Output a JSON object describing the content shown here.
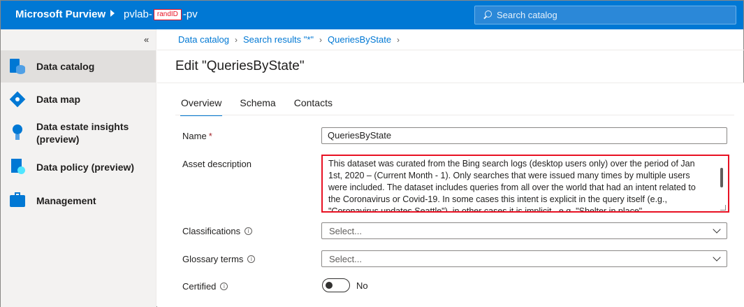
{
  "header": {
    "brand": "Microsoft Purview",
    "account_prefix": "pvlab-",
    "account_redacted": "randID",
    "account_suffix": "-pv",
    "search_placeholder": "Search catalog"
  },
  "sidebar": {
    "collapse_glyph": "«",
    "items": [
      {
        "label": "Data catalog",
        "icon": "data-catalog-icon",
        "active": true
      },
      {
        "label": "Data map",
        "icon": "data-map-icon"
      },
      {
        "label": "Data estate insights (preview)",
        "icon": "data-estate-insights-icon"
      },
      {
        "label": "Data policy (preview)",
        "icon": "data-policy-icon"
      },
      {
        "label": "Management",
        "icon": "management-icon"
      }
    ]
  },
  "breadcrumb": [
    "Data catalog",
    "Search results \"*\"",
    "QueriesByState"
  ],
  "page": {
    "title": "Edit \"QueriesByState\"",
    "tabs": [
      "Overview",
      "Schema",
      "Contacts"
    ],
    "active_tab": "Overview"
  },
  "form": {
    "name_label": "Name",
    "name_required": "*",
    "name_value": "QueriesByState",
    "description_label": "Asset description",
    "description_value": "This dataset was curated from the Bing search logs (desktop users only) over the period of Jan 1st, 2020 – (Current Month - 1). Only searches that were issued many times by multiple users were included. The dataset includes queries from all over the world that had an intent related to the Coronavirus or Covid-19. In some cases this intent is explicit in the query itself (e.g., \"Coronavirus updates Seattle\"), in other cases it is implicit , e.g. \"Shelter in place\"",
    "classifications_label": "Classifications",
    "classifications_placeholder": "Select...",
    "glossary_label": "Glossary terms",
    "glossary_placeholder": "Select...",
    "certified_label": "Certified",
    "certified_value": "No",
    "info_glyph": "i"
  },
  "colors": {
    "brand_blue": "#0078d4",
    "highlight_red": "#e81123"
  }
}
